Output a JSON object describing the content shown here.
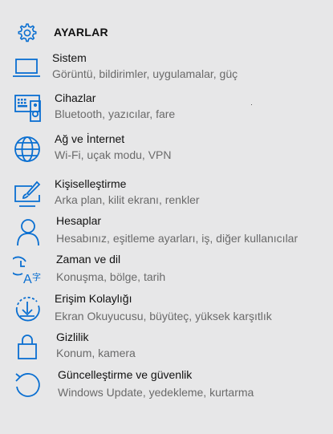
{
  "header": {
    "title": "AYARLAR",
    "icon": "gear-icon"
  },
  "accent_color": "#0a6fd1",
  "items": [
    {
      "name": "Sistem",
      "desc": "Görüntü, bildirimler, uygulamalar, güç",
      "icon": "laptop-icon"
    },
    {
      "name": "Cihazlar",
      "desc": "Bluetooth, yazıcılar, fare",
      "icon": "devices-icon"
    },
    {
      "name": "Ağ ve İnternet",
      "desc": "Wi-Fi, uçak modu, VPN",
      "icon": "globe-icon"
    },
    {
      "name": "Kişiselleştirme",
      "desc": "Arka plan, kilit ekranı, renkler",
      "icon": "personalization-icon"
    },
    {
      "name": "Hesaplar",
      "desc": "Hesabınız, eşitleme ayarları, iş, diğer kullanıcılar",
      "icon": "person-icon"
    },
    {
      "name": "Zaman ve dil",
      "desc": "Konuşma, bölge, tarih",
      "icon": "time-language-icon"
    },
    {
      "name": "Erişim Kolaylığı",
      "desc": "Ekran Okuyucusu, büyüteç, yüksek karşıtlık",
      "icon": "ease-of-access-icon"
    },
    {
      "name": "Gizlilik",
      "desc": "Konum, kamera",
      "icon": "lock-icon"
    },
    {
      "name": "Güncelleştirme ve güvenlik",
      "desc": "Windows Update, yedekleme, kurtarma",
      "icon": "update-icon"
    }
  ]
}
